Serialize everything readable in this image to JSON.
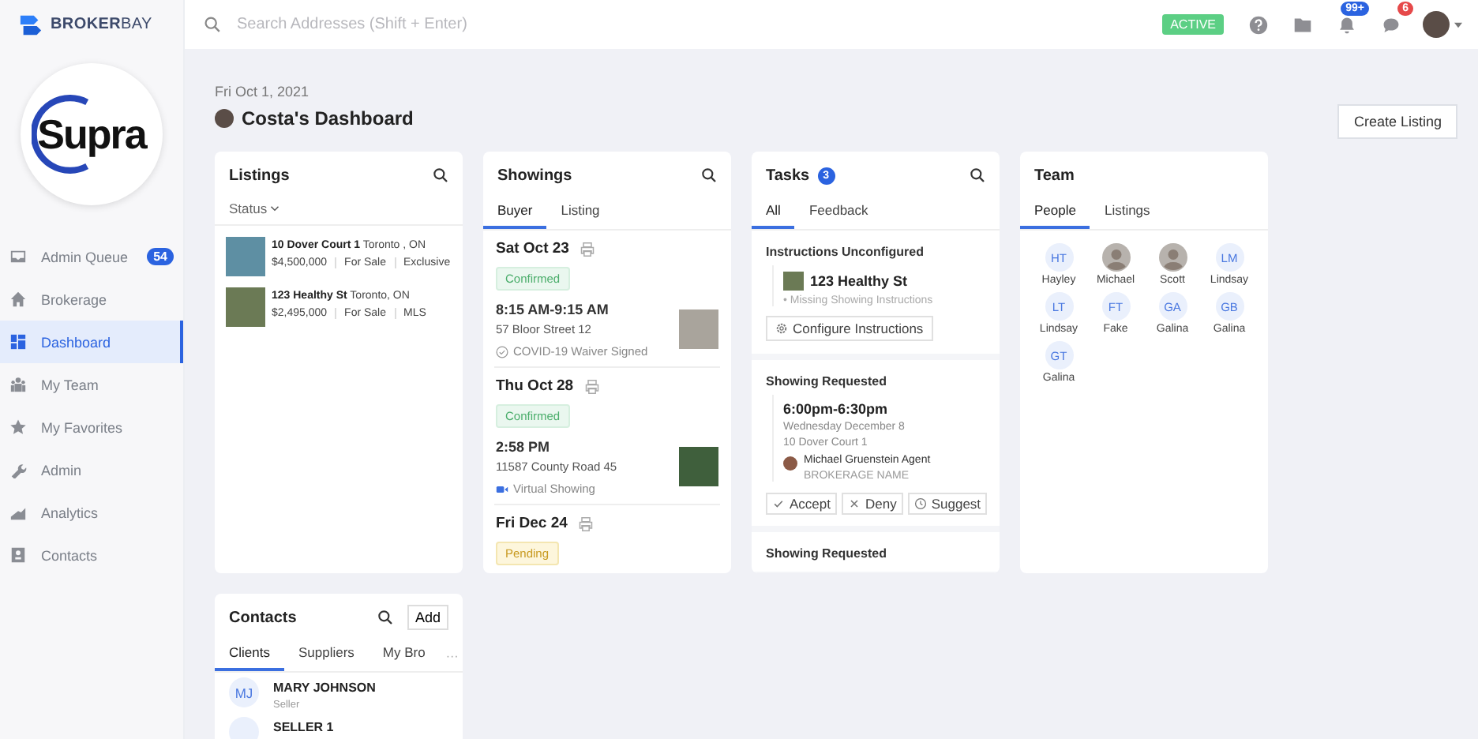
{
  "brand": {
    "logo": "**BROKER**BAY"
  },
  "search": {
    "placeholder": "Search Addresses (Shift + Enter)"
  },
  "topbar": {
    "status": "ACTIVE",
    "notification_count": "99+",
    "message_count": "6"
  },
  "brokerage_logo": "Supra",
  "sidebar": {
    "items": [
      {
        "label": "Admin Queue",
        "badge": "54",
        "selected": false
      },
      {
        "label": "Brokerage",
        "selected": false
      },
      {
        "label": "Dashboard",
        "selected": true
      },
      {
        "label": "My Team",
        "selected": false
      },
      {
        "label": "My Favorites",
        "selected": false
      },
      {
        "label": "Admin",
        "selected": false
      },
      {
        "label": "Analytics",
        "selected": false
      },
      {
        "label": "Contacts",
        "selected": false
      }
    ]
  },
  "header": {
    "date": "Fri Oct 1, 2021",
    "title": "Costa's Dashboard",
    "create_button": "Create Listing"
  },
  "listings": {
    "title": "Listings",
    "filter": "Status",
    "items": [
      {
        "address": "10 Dover Court 1",
        "city": "Toronto , ON",
        "price": "$4,500,000",
        "status": "For Sale",
        "type": "Exclusive"
      },
      {
        "address": "123 Healthy St",
        "city": "Toronto, ON",
        "price": "$2,495,000",
        "status": "For Sale",
        "type": "MLS"
      }
    ]
  },
  "showings": {
    "title": "Showings",
    "tabs": [
      {
        "label": "Buyer",
        "selected": true
      },
      {
        "label": "Listing",
        "selected": false
      }
    ],
    "days": [
      {
        "date": "Sat Oct 23",
        "status": {
          "label": "Confirmed",
          "kind": "confirmed"
        },
        "time": "8:15 AM-9:15 AM",
        "address": "57 Bloor Street 12",
        "note": {
          "kind": "waiver",
          "text": "COVID-19 Waiver Signed"
        }
      },
      {
        "date": "Thu Oct 28",
        "status": {
          "label": "Confirmed",
          "kind": "confirmed"
        },
        "time": "2:58 PM",
        "address": "11587 County Road 45",
        "note": {
          "kind": "virtual",
          "text": "Virtual Showing"
        }
      },
      {
        "date": "Fri Dec 24",
        "status": {
          "label": "Pending",
          "kind": "pending"
        }
      }
    ]
  },
  "tasks": {
    "title": "Tasks",
    "count": "3",
    "tabs": [
      {
        "label": "All",
        "selected": true
      },
      {
        "label": "Feedback",
        "selected": false
      }
    ],
    "groups": [
      {
        "kind": "unconfigured",
        "heading": "Instructions Unconfigured",
        "property": "123 Healthy St",
        "note": "• Missing Showing Instructions",
        "action": "Configure Instructions"
      },
      {
        "kind": "request",
        "heading": "Showing Requested",
        "time": "6:00pm-6:30pm",
        "date": "Wednesday December 8",
        "address": "10 Dover Court 1",
        "agent": "Michael Gruenstein Agent",
        "brokerage": "BROKERAGE NAME",
        "actions": [
          "Accept",
          "Deny",
          "Suggest"
        ]
      },
      {
        "kind": "request",
        "heading": "Showing Requested"
      }
    ]
  },
  "team": {
    "title": "Team",
    "tabs": [
      {
        "label": "People",
        "selected": true
      },
      {
        "label": "Listings",
        "selected": false
      }
    ],
    "members": [
      {
        "kind": "initials",
        "initials": "HT",
        "name": "Hayley"
      },
      {
        "kind": "photo",
        "name": "Michael"
      },
      {
        "kind": "photo",
        "name": "Scott"
      },
      {
        "kind": "initials",
        "initials": "LM",
        "name": "Lindsay"
      },
      {
        "kind": "initials",
        "initials": "LT",
        "name": "Lindsay"
      },
      {
        "kind": "initials",
        "initials": "FT",
        "name": "Fake"
      },
      {
        "kind": "initials",
        "initials": "GA",
        "name": "Galina"
      },
      {
        "kind": "initials",
        "initials": "GB",
        "name": "Galina"
      },
      {
        "kind": "initials",
        "initials": "GT",
        "name": "Galina"
      }
    ]
  },
  "contacts": {
    "title": "Contacts",
    "add_button": "Add",
    "more": "···",
    "tabs": [
      {
        "label": "Clients",
        "selected": true
      },
      {
        "label": "Suppliers",
        "selected": false
      },
      {
        "label": "My Bro",
        "selected": false
      }
    ],
    "items": [
      {
        "initials": "MJ",
        "name": "MARY JOHNSON",
        "role": "Seller"
      },
      {
        "name": "SELLER 1"
      }
    ]
  }
}
